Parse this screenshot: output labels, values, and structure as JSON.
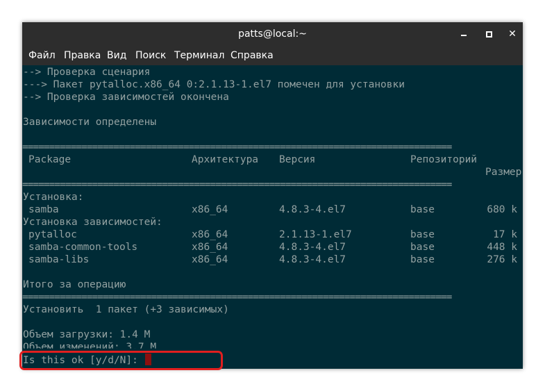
{
  "window": {
    "title": "patts@local:~",
    "controls": {
      "minimize": "minimize-icon",
      "maximize": "maximize-icon",
      "close": "close-icon"
    }
  },
  "menubar": {
    "items": [
      "Файл",
      "Правка",
      "Вид",
      "Поиск",
      "Терминал",
      "Справка"
    ]
  },
  "terminal": {
    "intro_lines": [
      "--> Проверка сценария",
      "---> Пакет pytalloc.x86_64 0:2.1.13-1.el7 помечен для установки",
      "--> Проверка зависимостей окончена",
      "",
      "Зависимости определены"
    ],
    "separator": "================================================================================",
    "table": {
      "headers": {
        "package": "Package",
        "arch": "Архитектура",
        "version": "Версия",
        "repo": "Репозиторий",
        "size": "Размер"
      },
      "sections": [
        {
          "title": "Установка:",
          "rows": [
            {
              "package": "samba",
              "arch": "x86_64",
              "version": "4.8.3-4.el7",
              "repo": "base",
              "size": "680 k"
            }
          ]
        },
        {
          "title": "Установка зависимостей:",
          "rows": [
            {
              "package": "pytalloc",
              "arch": "x86_64",
              "version": "2.1.13-1.el7",
              "repo": "base",
              "size": "17 k"
            },
            {
              "package": "samba-common-tools",
              "arch": "x86_64",
              "version": "4.8.3-4.el7",
              "repo": "base",
              "size": "448 k"
            },
            {
              "package": "samba-libs",
              "arch": "x86_64",
              "version": "4.8.3-4.el7",
              "repo": "base",
              "size": "276 k"
            }
          ]
        }
      ]
    },
    "summary_title": "Итого за операцию",
    "install_summary": "Установить  1 пакет (+3 зависимых)",
    "download_size": "Объем загрузки: 1.4 M",
    "installed_size": "Объем изменений: 3.7 M",
    "prompt": "Is this ok [y/d/N]: "
  },
  "colors": {
    "terminal_bg": "#002b36",
    "terminal_fg": "#93a1a1",
    "titlebar_bg": "#2d2d2d",
    "cursor": "#8b0f0f",
    "highlight_border": "#e01f1f"
  }
}
